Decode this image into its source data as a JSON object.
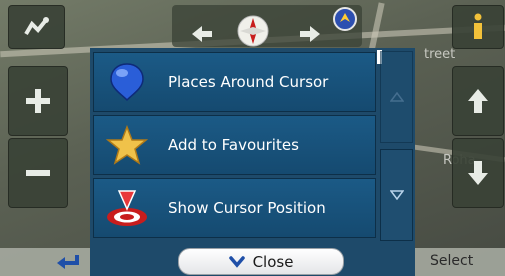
{
  "map": {
    "street_top": "treet",
    "street_right": "Roha"
  },
  "menu": {
    "items": [
      {
        "label": "Places Around Cursor",
        "icon": "globe-pin-icon"
      },
      {
        "label": "Add to Favourites",
        "icon": "star-icon"
      },
      {
        "label": "Show Cursor Position",
        "icon": "cursor-target-icon"
      }
    ],
    "scroll_up_icon": "triangle-up-icon",
    "scroll_down_icon": "triangle-down-icon"
  },
  "bottom": {
    "close_label": "Close",
    "select_label": "Select",
    "back_icon": "back-arrow-icon"
  },
  "colors": {
    "menu_bg": "#1e4a6a",
    "item_bg": "#1b5a86",
    "accent": "#1b5a86"
  }
}
